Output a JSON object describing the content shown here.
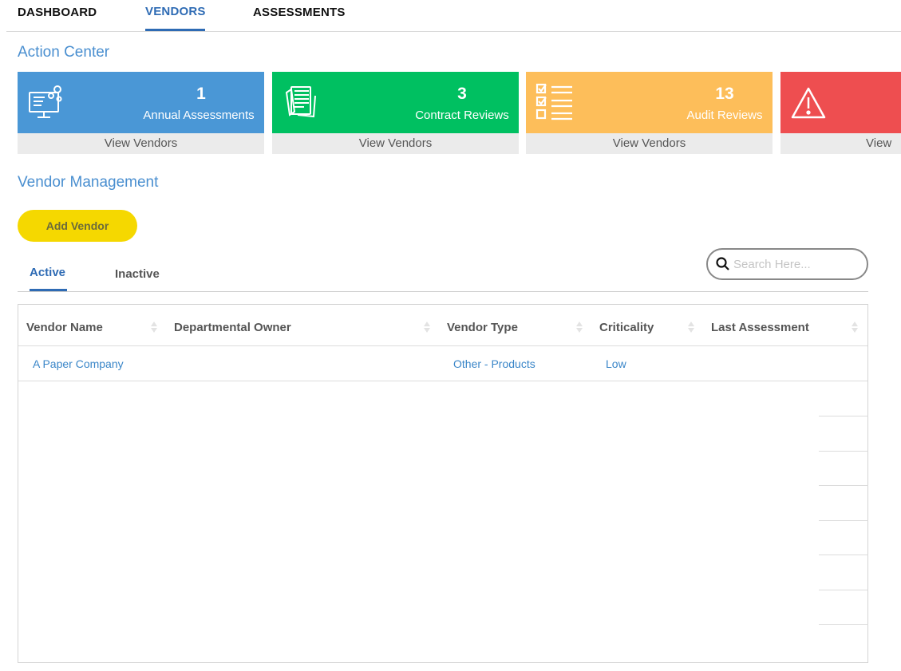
{
  "nav": {
    "items": [
      {
        "label": "DASHBOARD"
      },
      {
        "label": "VENDORS"
      },
      {
        "label": "ASSESSMENTS"
      }
    ]
  },
  "action_center": {
    "title": "Action Center",
    "cards": [
      {
        "count": "1",
        "label": "Annual Assessments",
        "footer": "View Vendors",
        "color": "#4a97d6",
        "icon": "monitor-gear-icon"
      },
      {
        "count": "3",
        "label": "Contract Reviews",
        "footer": "View Vendors",
        "color": "#00c061",
        "icon": "documents-icon"
      },
      {
        "count": "13",
        "label": "Audit Reviews",
        "footer": "View Vendors",
        "color": "#fdbe5a",
        "icon": "checklist-icon"
      },
      {
        "count": "",
        "label": "",
        "footer": "View V",
        "color": "#ee4e50",
        "icon": "warning-icon"
      }
    ]
  },
  "vendor_management": {
    "title": "Vendor Management",
    "add_button": "Add Vendor",
    "tabs": [
      {
        "label": "Active"
      },
      {
        "label": "Inactive"
      }
    ],
    "search": {
      "placeholder": "Search Here..."
    },
    "table": {
      "columns": [
        "Vendor Name",
        "Departmental Owner",
        "Vendor Type",
        "Criticality",
        "Last Assessment"
      ],
      "rows": [
        {
          "vendor_name": "A Paper Company",
          "departmental_owner": "",
          "vendor_type": "Other - Products",
          "criticality": "Low",
          "last_assessment": ""
        }
      ]
    }
  }
}
